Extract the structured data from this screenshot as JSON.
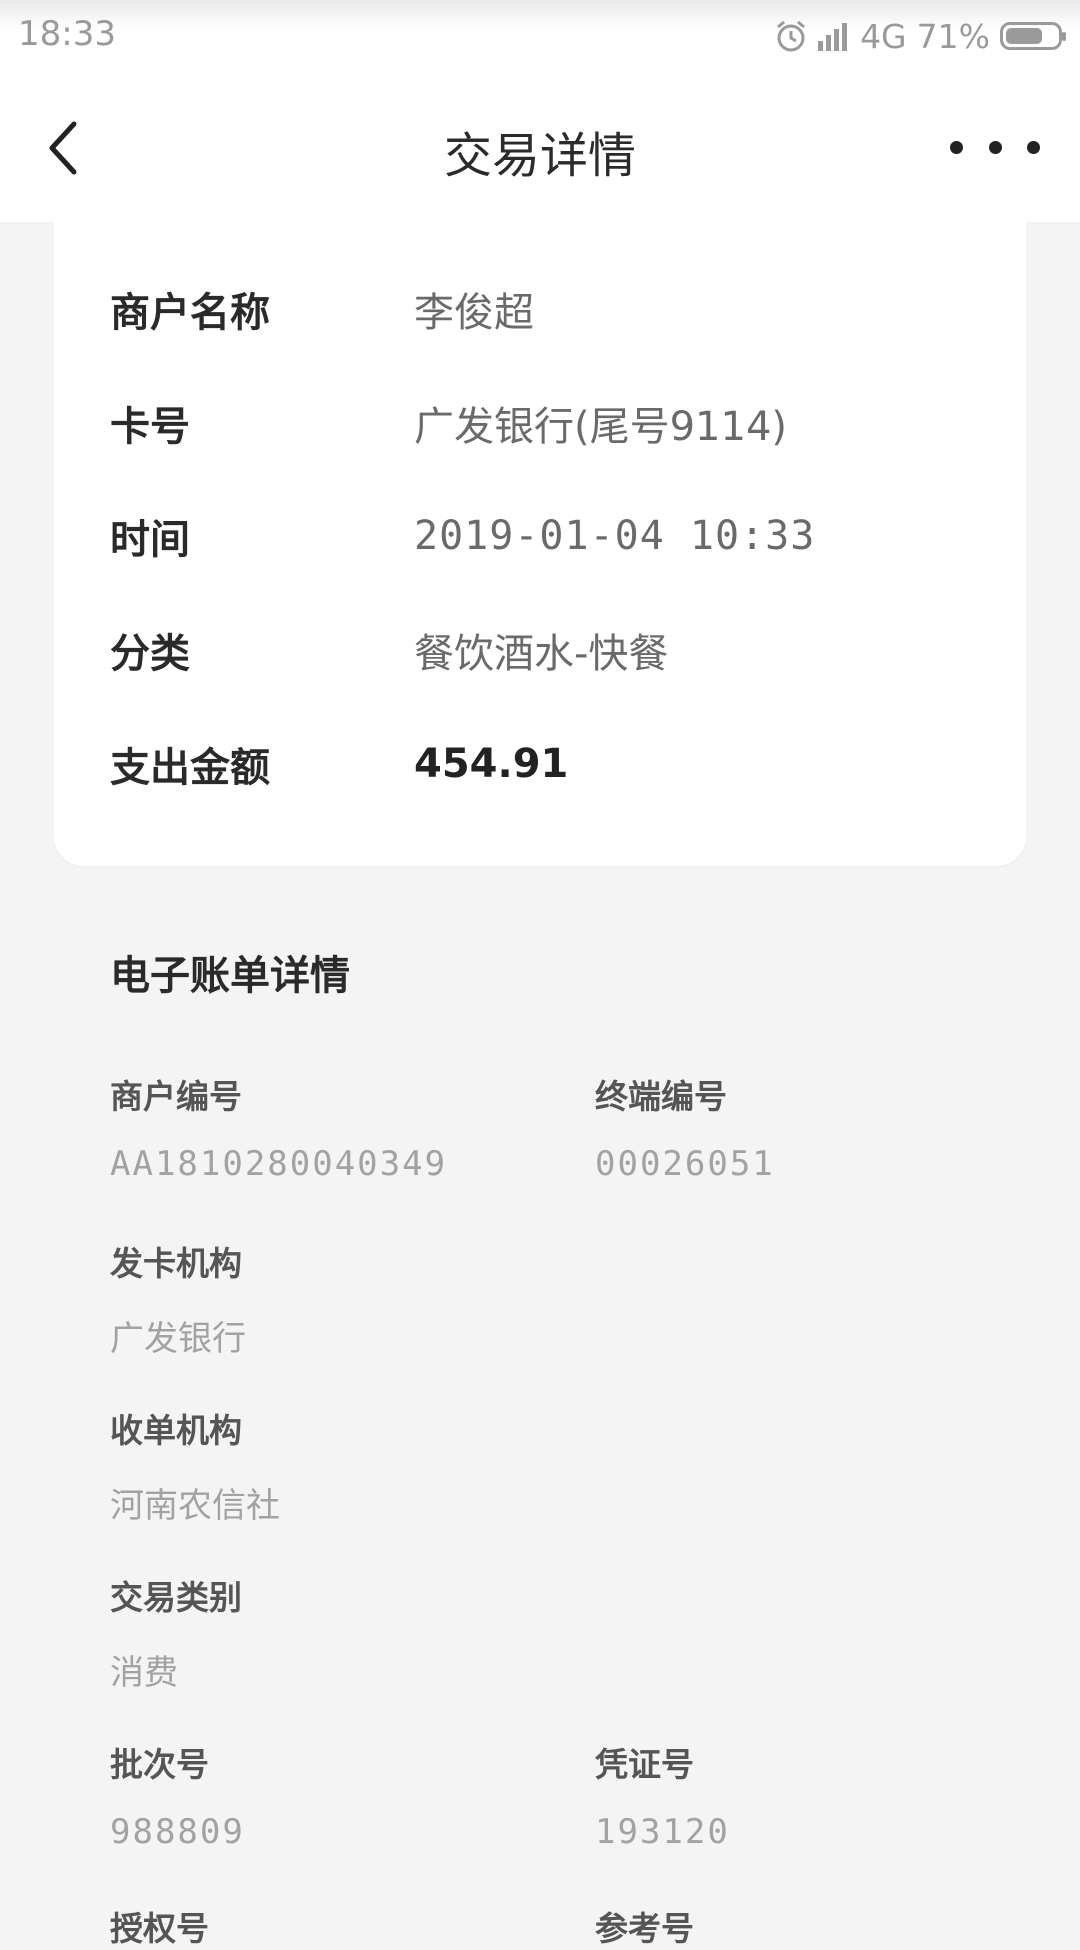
{
  "status_bar": {
    "time": "18:33",
    "network": "4G",
    "battery": "71%",
    "battery_level": 0.71,
    "icons": [
      "alarm-icon",
      "hd-signal-icon",
      "battery-icon"
    ]
  },
  "nav": {
    "title": "交易详情",
    "back_icon": "chevron-left-icon",
    "more_icon": "more-dots-icon"
  },
  "summary": {
    "rows": [
      {
        "label": "商户名称",
        "value": "李俊超"
      },
      {
        "label": "卡号",
        "value": "广发银行(尾号9114)"
      },
      {
        "label": "时间",
        "value": "2019-01-04 10:33"
      },
      {
        "label": "分类",
        "value": "餐饮酒水-快餐"
      },
      {
        "label": "支出金额",
        "value": "454.91"
      }
    ]
  },
  "ebill": {
    "title": "电子账单详情",
    "fields": [
      {
        "label": "商户编号",
        "value": "AA1810280040349"
      },
      {
        "label": "终端编号",
        "value": "00026051"
      },
      {
        "label": "发卡机构",
        "value": "广发银行"
      },
      {
        "label": "收单机构",
        "value": "河南农信社"
      },
      {
        "label": "交易类别",
        "value": "消费"
      },
      {
        "label": "批次号",
        "value": "988809"
      },
      {
        "label": "凭证号",
        "value": "193120"
      },
      {
        "label": "授权号",
        "value": ""
      },
      {
        "label": "参考号",
        "value": ""
      }
    ]
  }
}
